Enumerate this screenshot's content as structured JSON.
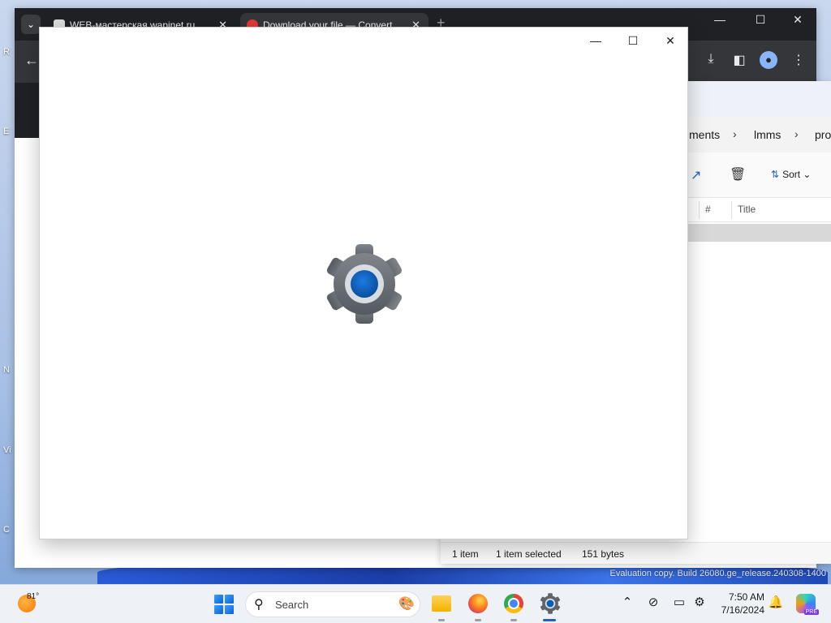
{
  "desktop": {
    "fragments": [
      "R",
      "E",
      "N",
      "Vi",
      "C"
    ],
    "watermark": "Evaluation copy. Build 26080.ge_release.240308-1400"
  },
  "browser": {
    "tabs": [
      {
        "title": "WEB-мастерская wapinet.ru"
      },
      {
        "title": "Download your file — Convert"
      }
    ],
    "tab_close": "✕",
    "new_tab": "+",
    "menu": "⌄"
  },
  "explorer": {
    "breadcrumbs": [
      "ments",
      "lmms",
      "pro"
    ],
    "sort_label": "Sort",
    "columns": [
      "#",
      "Title"
    ],
    "status": {
      "items": "1 item",
      "selected": "1 item selected",
      "size": "151 bytes"
    }
  },
  "settings_splash": {
    "controls": {
      "minimize": "—",
      "maximize": "☐",
      "close": "✕"
    },
    "icon": "settings-gear-icon"
  },
  "taskbar": {
    "weather_temp": "81°",
    "search_placeholder": "Search",
    "time": "7:50 AM",
    "date": "7/16/2024",
    "apps": [
      "start",
      "search",
      "file-explorer",
      "firefox",
      "chrome",
      "settings"
    ],
    "copilot_badge": "PRE"
  },
  "colors": {
    "accent": "#1e62c6",
    "browser_frame": "#202124",
    "gear_body": "#6b6f76",
    "gear_core": "#0a5cb8"
  }
}
